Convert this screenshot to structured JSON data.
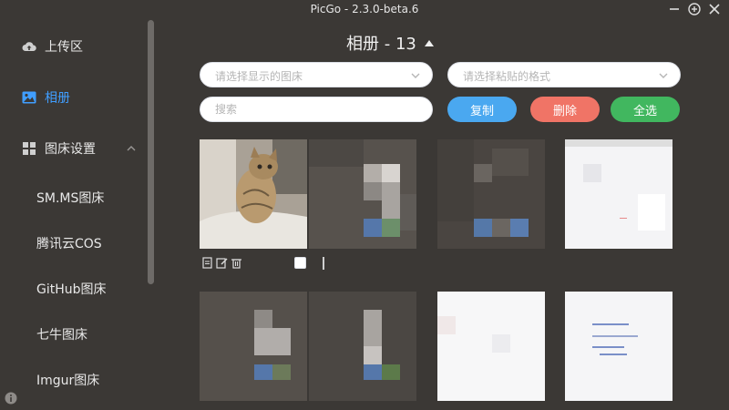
{
  "window": {
    "title": "PicGo - 2.3.0-beta.6"
  },
  "sidebar": {
    "items": [
      {
        "label": "上传区",
        "icon": "cloud-upload-icon"
      },
      {
        "label": "相册",
        "icon": "image-icon",
        "active": true
      },
      {
        "label": "图床设置",
        "icon": "grid-icon",
        "expanded": true
      }
    ],
    "sub_items": [
      {
        "label": "SM.MS图床"
      },
      {
        "label": "腾讯云COS"
      },
      {
        "label": "GitHub图床"
      },
      {
        "label": "七牛图床"
      },
      {
        "label": "Imgur图床"
      }
    ]
  },
  "gallery": {
    "title": "相册 - 13",
    "picbed_select": {
      "placeholder": "请选择显示的图床"
    },
    "paste_format_select": {
      "placeholder": "请选择粘贴的格式"
    },
    "search": {
      "placeholder": "搜索"
    },
    "buttons": {
      "copy": "复制",
      "delete": "删除",
      "select_all": "全选"
    }
  },
  "colors": {
    "background": "#3b3835",
    "active": "#409eff",
    "copy": "#4aa8f0",
    "delete": "#f07466",
    "select_all": "#41b75f"
  }
}
